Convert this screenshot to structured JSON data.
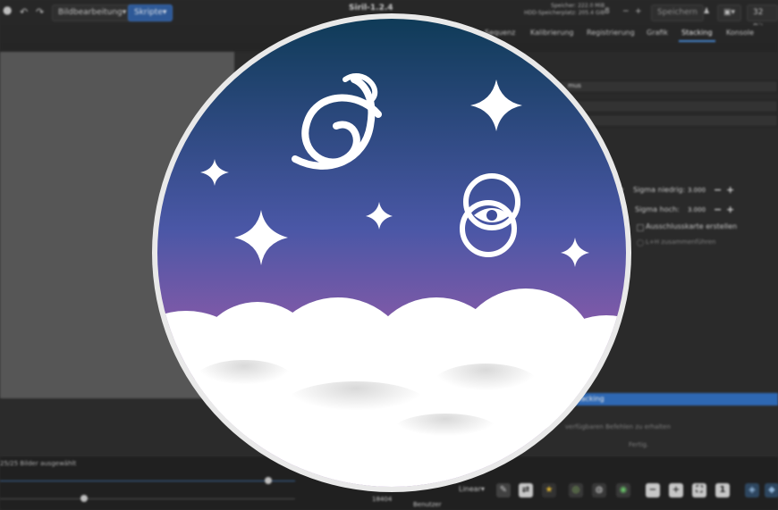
{
  "header": {
    "image_processing_label": "Bildbearbeitung",
    "scripts_label": "Skripte",
    "window_title": "Siril-1.2.4",
    "memory_label": "Speicher: 222.0 MiB",
    "disk_label": "HDD-Speicherplatz: 205.4 GiB",
    "thread_count": "8",
    "save_label": "Speichern",
    "bit_depth_label": "32 Bit"
  },
  "tabs": {
    "sequence": "Sequenz",
    "calibration": "Kalibrierung",
    "registration": "Registrierung",
    "graphic": "Grafik",
    "stacking": "Stacking",
    "console": "Konsole"
  },
  "panel": {
    "method_suffix": "mus",
    "sigma_low_label": "Sigma niedrig:",
    "sigma_low_value": "3.000",
    "sigma_high_label": "Sigma hoch:",
    "sigma_high_value": "3.000",
    "rejection_map_label": "Ausschlusskarte erstellen",
    "merge_lh_label": "L+H zusammenführen",
    "start_stacking_label": "Starte Stacking",
    "available_commands_text": "verfügbaren Befehlen zu erhalten",
    "done_text": "Fertig."
  },
  "bottom": {
    "selected_images": "25/25 Bilder ausgewählt",
    "max_value": "18404",
    "user_label": "Benutzer",
    "stretch_mode": "Linear",
    "slider_low_fraction": 0.11,
    "slider_high_fraction": 0.35
  },
  "logo": {
    "sky_top_color": "#0d3a55",
    "sky_mid_color": "#4a57a6",
    "sky_bottom_color": "#8a5aa8",
    "rim_color": "#e9e9e9",
    "symbols": [
      "spiral-galaxy-icon",
      "sparkle-star-icon",
      "eye-rings-icon",
      "cloud-bank"
    ]
  }
}
